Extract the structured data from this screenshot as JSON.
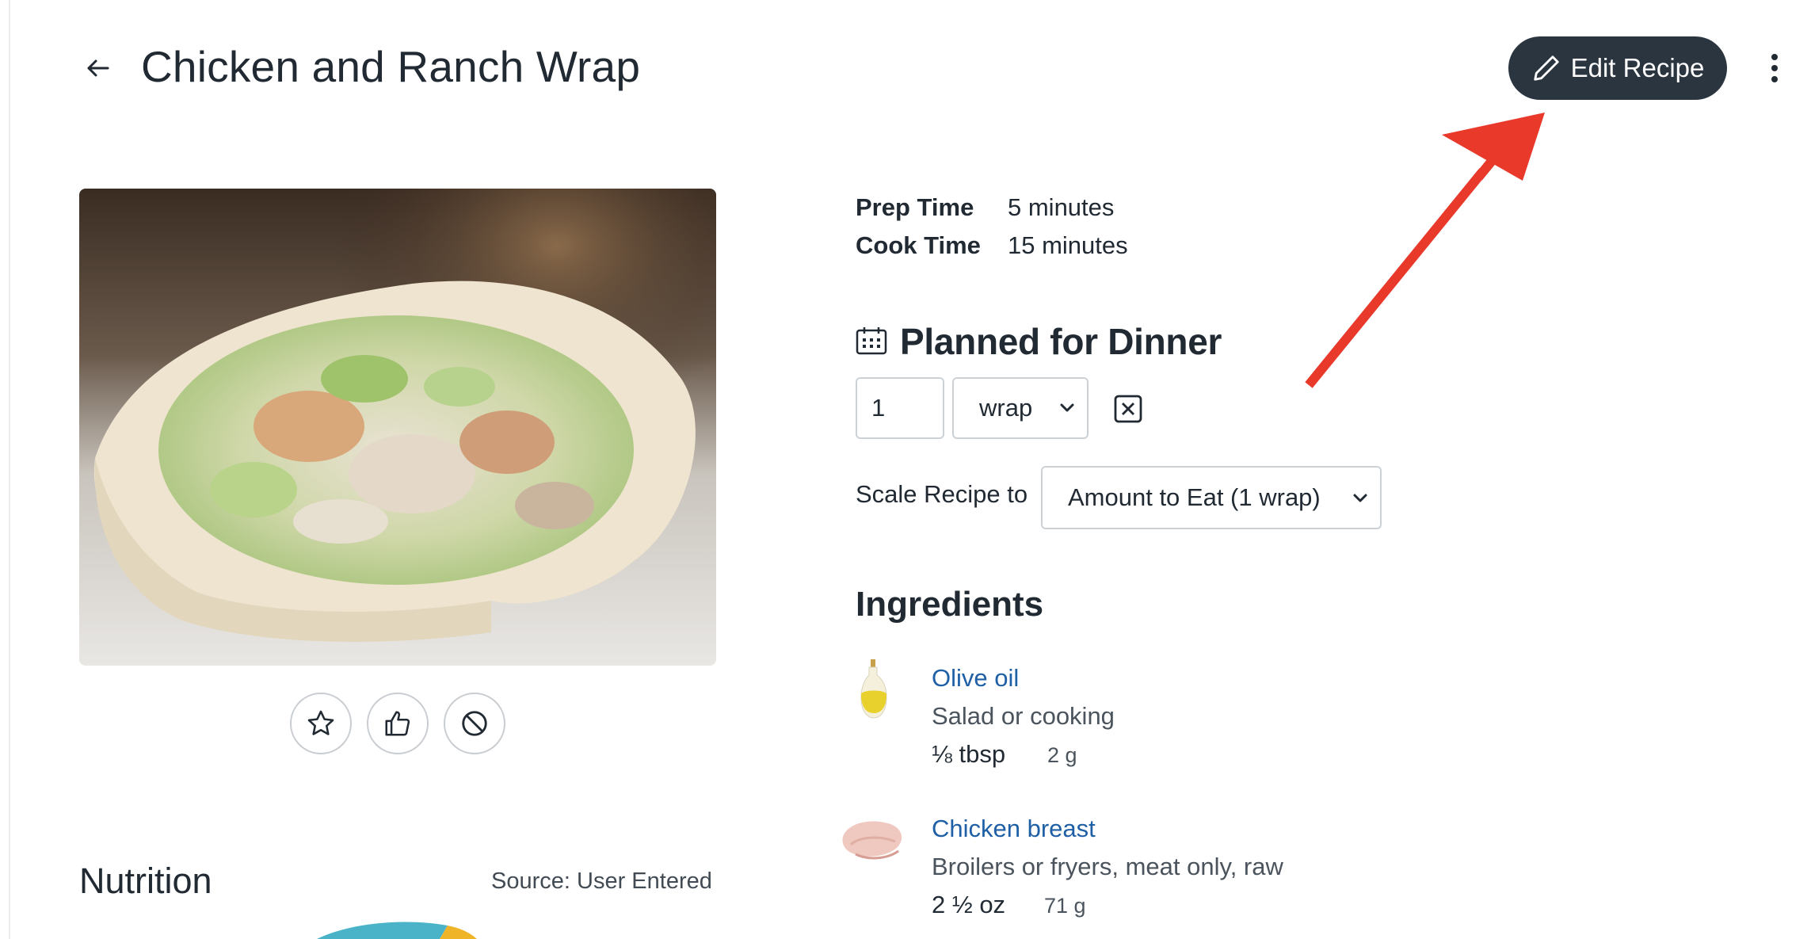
{
  "header": {
    "back_icon": "arrow-left-icon",
    "title": "Chicken and Ranch Wrap",
    "edit_button_label": "Edit Recipe",
    "edit_icon": "pencil-icon",
    "more_icon": "more-vertical-icon"
  },
  "image": {
    "alt": "Chicken and Ranch Wrap"
  },
  "actions": {
    "favorite_icon": "star-icon",
    "like_icon": "thumbs-up-icon",
    "block_icon": "ban-icon"
  },
  "nutrition": {
    "title": "Nutrition",
    "source": "Source: User Entered"
  },
  "times": [
    {
      "label": "Prep Time",
      "value": "5 minutes"
    },
    {
      "label": "Cook Time",
      "value": "15 minutes"
    }
  ],
  "planned": {
    "icon": "calendar-icon",
    "title": "Planned for Dinner",
    "quantity": "1",
    "unit": "wrap",
    "remove_icon": "x-square-icon"
  },
  "scale": {
    "label": "Scale Recipe to",
    "selected": "Amount to Eat (1 wrap)"
  },
  "ingredients": {
    "title": "Ingredients",
    "items": [
      {
        "name": "Olive oil",
        "description": "Salad or cooking",
        "amount": "⅛ tbsp",
        "grams": "2 g",
        "icon": "olive-oil-icon"
      },
      {
        "name": "Chicken breast",
        "description": "Broilers or fryers, meat only, raw",
        "amount": "2 ½ oz",
        "grams": "71 g",
        "icon": "chicken-breast-icon"
      }
    ]
  },
  "colors": {
    "primary_dark": "#2b3540",
    "link": "#1f5fa6",
    "annotation_arrow": "#e8392b",
    "chart_teal": "#4ab3c8",
    "chart_yellow": "#f0b429"
  }
}
